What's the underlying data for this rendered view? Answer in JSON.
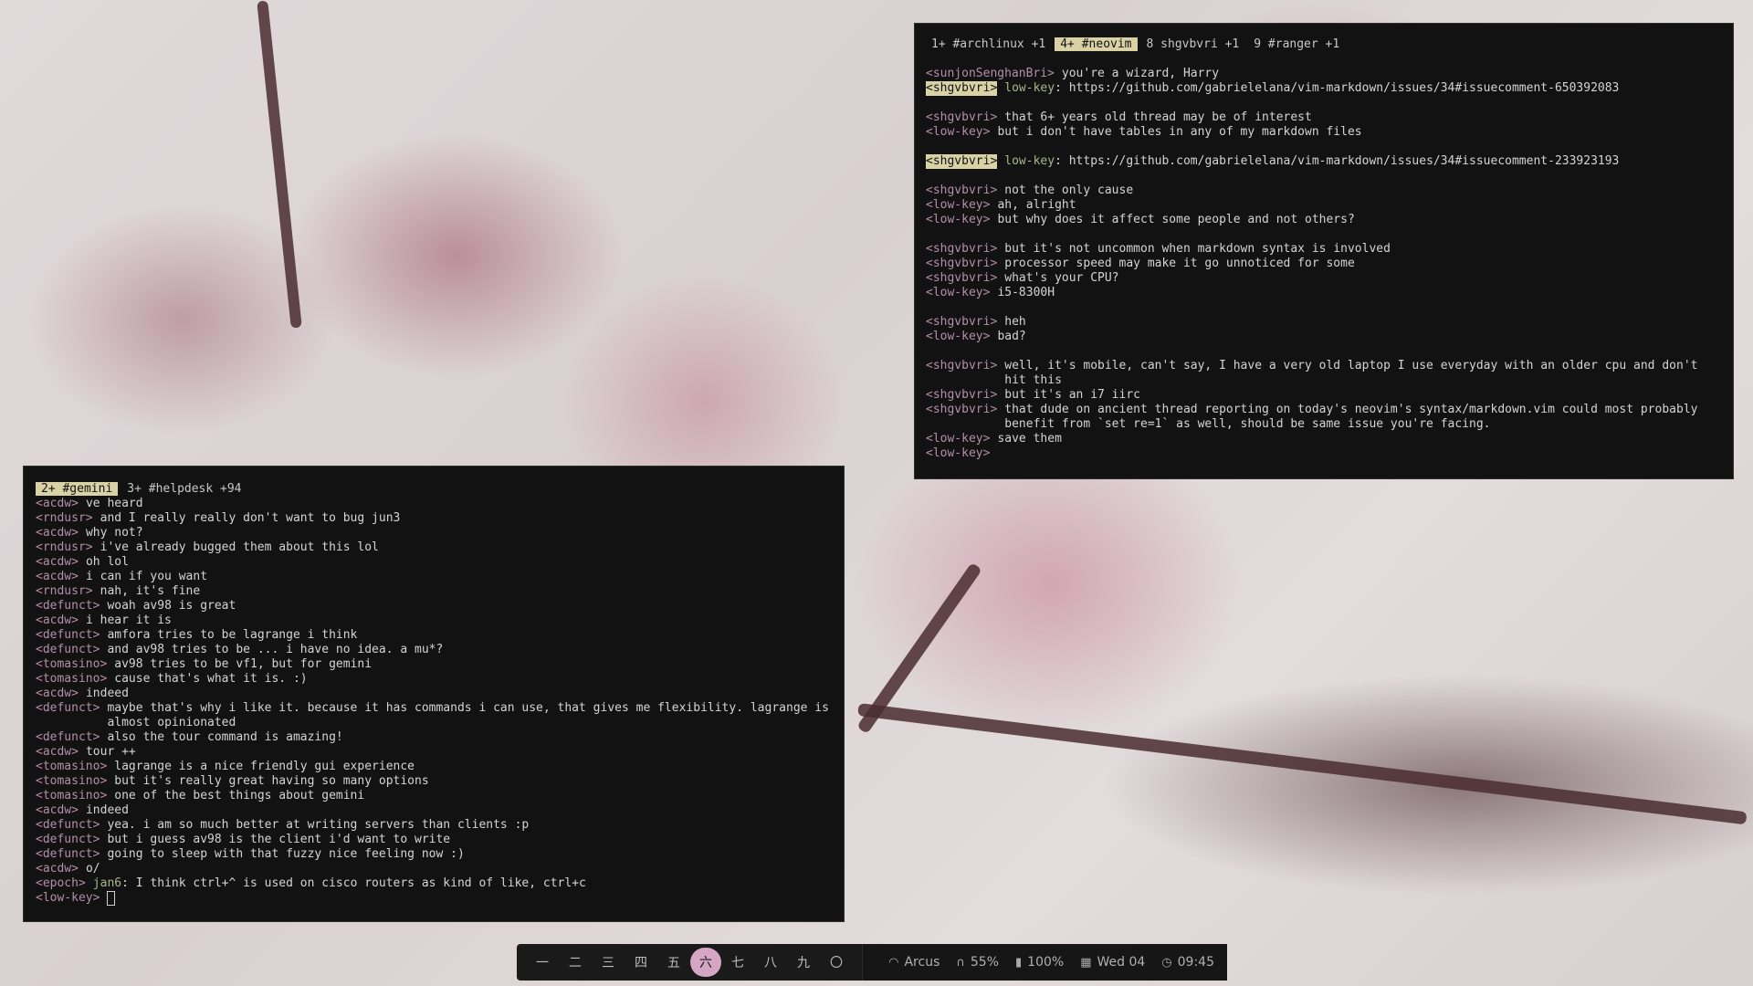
{
  "neovim_window": {
    "tabs": [
      {
        "label": "1+ #archlinux +1",
        "active": false
      },
      {
        "label": "4+ #neovim",
        "active": true
      },
      {
        "label": "8 shgvbvri +1",
        "active": false
      },
      {
        "label": "9 #ranger +1",
        "active": false
      }
    ],
    "lines": [
      {
        "nick": "<sunjonSenghanBri>",
        "text": "you're a wizard, Harry"
      },
      {
        "nick": "<shgvbvri>",
        "mention": "low-key",
        "text": ": https://github.com/gabrielelana/vim-markdown/issues/34#issuecomment-650392083",
        "hl": true
      },
      {
        "gap": true
      },
      {
        "nick": "<shgvbvri>",
        "text": "that 6+ years old thread may be of interest"
      },
      {
        "nick": "<low-key>",
        "text": "but i don't have tables in any of my markdown files"
      },
      {
        "gap": true
      },
      {
        "nick": "<shgvbvri>",
        "mention": "low-key",
        "text": ": https://github.com/gabrielelana/vim-markdown/issues/34#issuecomment-233923193",
        "hl": true
      },
      {
        "gap": true
      },
      {
        "nick": "<shgvbvri>",
        "text": "not the only cause"
      },
      {
        "nick": "<low-key>",
        "text": "ah, alright"
      },
      {
        "nick": "<low-key>",
        "text": "but why does it affect some people and not others?"
      },
      {
        "gap": true
      },
      {
        "nick": "<shgvbvri>",
        "text": "but it's not uncommon when markdown syntax is involved"
      },
      {
        "nick": "<shgvbvri>",
        "text": "processor speed may make it go unnoticed for some"
      },
      {
        "nick": "<shgvbvri>",
        "text": "what's your CPU?"
      },
      {
        "nick": "<low-key>",
        "text": "i5-8300H"
      },
      {
        "gap": true
      },
      {
        "nick": "<shgvbvri>",
        "text": "heh"
      },
      {
        "nick": "<low-key>",
        "text": "bad?"
      },
      {
        "gap": true
      },
      {
        "nick": "<shgvbvri>",
        "text": "well, it's mobile, can't say, I have a very old laptop I use everyday with an older cpu and don't hit this"
      },
      {
        "nick": "<shgvbvri>",
        "text": "but it's an i7 iirc"
      },
      {
        "nick": "<shgvbvri>",
        "text": "that dude on ancient thread reporting on today's neovim's syntax/markdown.vim could most probably benefit from `set re=1` as well, should be same issue you're facing."
      },
      {
        "nick": "<low-key>",
        "text": "save them"
      },
      {
        "nick": "<low-key>",
        "text": ""
      }
    ]
  },
  "gemini_window": {
    "tabs": [
      {
        "label": "2+ #gemini",
        "active": true
      },
      {
        "label": "3+ #helpdesk +94",
        "active": false
      }
    ],
    "lines": [
      {
        "nick": "<acdw>",
        "text": "ve heard"
      },
      {
        "nick": "<rndusr>",
        "text": "and I really really don't want to bug jun3"
      },
      {
        "nick": "<acdw>",
        "text": "why not?"
      },
      {
        "nick": "<rndusr>",
        "text": "i've already bugged them about this lol"
      },
      {
        "nick": "<acdw>",
        "text": "oh lol"
      },
      {
        "nick": "<acdw>",
        "text": "i can if you want"
      },
      {
        "nick": "<rndusr>",
        "text": "nah, it's fine"
      },
      {
        "nick": "<defunct>",
        "text": "woah av98 is great"
      },
      {
        "nick": "<acdw>",
        "text": "i hear it is"
      },
      {
        "nick": "<defunct>",
        "text": "amfora tries to be lagrange i think"
      },
      {
        "nick": "<defunct>",
        "text": "and av98 tries to be ... i have no idea. a mu*?"
      },
      {
        "nick": "<tomasino>",
        "text": "av98 tries to be vf1, but for gemini"
      },
      {
        "nick": "<tomasino>",
        "text": "cause that's what it is. :)"
      },
      {
        "nick": "<acdw>",
        "text": "indeed"
      },
      {
        "nick": "<defunct>",
        "text": "maybe that's why i like it. because it has commands i can use, that gives me flexibility. lagrange is almost opinionated"
      },
      {
        "nick": "<defunct>",
        "text": "also the tour command is amazing!"
      },
      {
        "nick": "<acdw>",
        "text": "tour ++"
      },
      {
        "nick": "<tomasino>",
        "text": "lagrange is a nice friendly gui experience"
      },
      {
        "nick": "<tomasino>",
        "text": "but it's really great having so many options"
      },
      {
        "nick": "<tomasino>",
        "text": "one of the best things about gemini"
      },
      {
        "nick": "<acdw>",
        "text": "indeed"
      },
      {
        "nick": "<defunct>",
        "text": "yea. i am so much better at writing servers than clients :p"
      },
      {
        "nick": "<defunct>",
        "text": "but i guess av98 is the client i'd want to write"
      },
      {
        "nick": "<defunct>",
        "text": "going to sleep with that fuzzy nice feeling now :)"
      },
      {
        "nick": "<acdw>",
        "text": "o/"
      },
      {
        "nick": "<epoch>",
        "mention": "jan6",
        "text": ": I think ctrl+^ is used on cisco routers as kind of like, ctrl+c"
      },
      {
        "nick": "<low-key>",
        "text": "",
        "cursor": true
      }
    ]
  },
  "bar": {
    "workspaces": [
      {
        "label": "一",
        "active": false
      },
      {
        "label": "二",
        "active": false
      },
      {
        "label": "三",
        "active": false
      },
      {
        "label": "四",
        "active": false
      },
      {
        "label": "五",
        "active": false
      },
      {
        "label": "六",
        "active": true
      },
      {
        "label": "七",
        "active": false
      },
      {
        "label": "八",
        "active": false
      },
      {
        "label": "九",
        "active": false
      },
      {
        "label": "〇",
        "active": false
      }
    ],
    "wifi": {
      "icon": "wifi-icon",
      "text": "Arcus"
    },
    "volume": {
      "icon": "headphones-icon",
      "text": "55%"
    },
    "battery": {
      "icon": "battery-icon",
      "text": "100%"
    },
    "date": {
      "icon": "calendar-icon",
      "text": "Wed 04"
    },
    "clock": {
      "icon": "clock-icon",
      "text": "09:45"
    }
  },
  "colors": {
    "accent_tab": "#d9d2a4",
    "nick": "#b48fa8",
    "mention": "#a6b88a",
    "active_workspace": "#d4a6c4"
  }
}
